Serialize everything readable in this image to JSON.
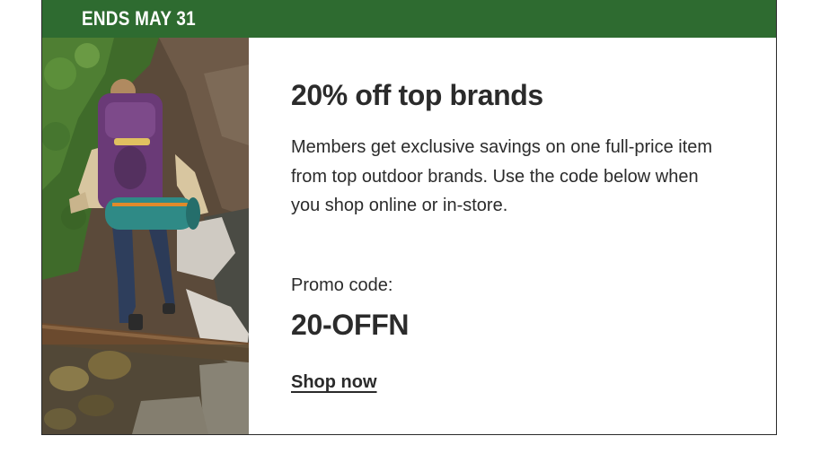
{
  "banner": {
    "text": "ENDS MAY 31",
    "color": "#2e6b30"
  },
  "photo": {
    "subject": "backpacker-crossing-log-bridge",
    "alt": ""
  },
  "promo": {
    "headline": "20% off top brands",
    "description": "Members get exclusive savings on one full-price item from top outdoor brands. Use the code below when you shop online or in-store.",
    "code_label": "Promo code:",
    "code": "20-OFFN",
    "cta_label": "Shop now"
  },
  "colors": {
    "text": "#2b2b2b",
    "background": "#ffffff",
    "border": "#2b2b2b"
  }
}
